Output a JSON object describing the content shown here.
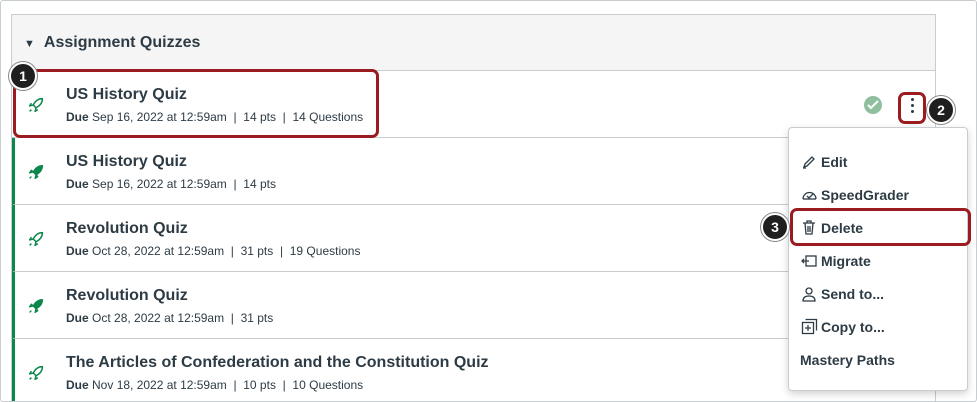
{
  "group": {
    "title": "Assignment Quizzes"
  },
  "quizzes": [
    {
      "title": "US History Quiz",
      "due_label": "Due",
      "due": "Sep 16, 2022 at 12:59am",
      "points": "14 pts",
      "questions": "14 Questions",
      "published": false
    },
    {
      "title": "US History Quiz",
      "due_label": "Due",
      "due": "Sep 16, 2022 at 12:59am",
      "points": "14 pts",
      "questions": "",
      "published": true
    },
    {
      "title": "Revolution Quiz",
      "due_label": "Due",
      "due": "Oct 28, 2022 at 12:59am",
      "points": "31 pts",
      "questions": "19 Questions",
      "published": true
    },
    {
      "title": "Revolution Quiz",
      "due_label": "Due",
      "due": "Oct 28, 2022 at 12:59am",
      "points": "31 pts",
      "questions": "",
      "published": true
    },
    {
      "title": "The Articles of Confederation and the Constitution Quiz",
      "due_label": "Due",
      "due": "Nov 18, 2022 at 12:59am",
      "points": "10 pts",
      "questions": "10 Questions",
      "published": true
    }
  ],
  "menu": {
    "items": [
      {
        "label": "Edit",
        "icon": "pencil-icon"
      },
      {
        "label": "SpeedGrader",
        "icon": "speedgrader-icon"
      },
      {
        "label": "Delete",
        "icon": "trash-icon"
      },
      {
        "label": "Migrate",
        "icon": "migrate-icon"
      },
      {
        "label": "Send to...",
        "icon": "user-icon"
      },
      {
        "label": "Copy to...",
        "icon": "copy-icon"
      },
      {
        "label": "Mastery Paths",
        "icon": ""
      }
    ]
  },
  "callouts": [
    "1",
    "2",
    "3"
  ],
  "colors": {
    "highlight": "#9b1c20",
    "published": "#0b874b",
    "text": "#2d3b45"
  },
  "sep": "|"
}
